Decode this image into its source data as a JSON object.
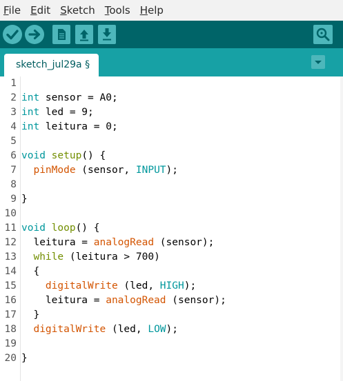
{
  "menubar": {
    "items": [
      {
        "label": "File",
        "mnemonic": "F",
        "rest": "ile"
      },
      {
        "label": "Edit",
        "mnemonic": "E",
        "rest": "dit"
      },
      {
        "label": "Sketch",
        "mnemonic": "S",
        "rest": "ketch"
      },
      {
        "label": "Tools",
        "mnemonic": "T",
        "rest": "ools"
      },
      {
        "label": "Help",
        "mnemonic": "H",
        "rest": "elp"
      }
    ]
  },
  "toolbar": {
    "buttons": [
      {
        "name": "verify",
        "icon": "check-icon"
      },
      {
        "name": "upload",
        "icon": "arrow-right-icon"
      },
      {
        "name": "new",
        "icon": "new-file-icon"
      },
      {
        "name": "open",
        "icon": "arrow-up-icon"
      },
      {
        "name": "save",
        "icon": "arrow-down-icon"
      },
      {
        "name": "serial-monitor",
        "icon": "magnifier-icon"
      }
    ],
    "background_color": "#006468",
    "button_color": "#4db7bb"
  },
  "tabs": {
    "active_label": "sketch_jul29a §",
    "menu_icon": "triangle-down-icon"
  },
  "editor": {
    "lines": [
      {
        "n": "1",
        "tokens": []
      },
      {
        "n": "2",
        "tokens": [
          [
            "type",
            "int"
          ],
          [
            "plain",
            " sensor = A0;"
          ]
        ]
      },
      {
        "n": "3",
        "tokens": [
          [
            "type",
            "int"
          ],
          [
            "plain",
            " led = 9;"
          ]
        ]
      },
      {
        "n": "4",
        "tokens": [
          [
            "type",
            "int"
          ],
          [
            "plain",
            " leitura = 0;"
          ]
        ]
      },
      {
        "n": "5",
        "tokens": []
      },
      {
        "n": "6",
        "tokens": [
          [
            "type",
            "void"
          ],
          [
            "plain",
            " "
          ],
          [
            "ctrl",
            "setup"
          ],
          [
            "plain",
            "() {"
          ]
        ]
      },
      {
        "n": "7",
        "tokens": [
          [
            "plain",
            "  "
          ],
          [
            "func",
            "pinMode"
          ],
          [
            "plain",
            " (sensor, "
          ],
          [
            "const",
            "INPUT"
          ],
          [
            "plain",
            ");"
          ]
        ]
      },
      {
        "n": "8",
        "tokens": []
      },
      {
        "n": "9",
        "tokens": [
          [
            "plain",
            "}"
          ]
        ]
      },
      {
        "n": "10",
        "tokens": []
      },
      {
        "n": "11",
        "tokens": [
          [
            "type",
            "void"
          ],
          [
            "plain",
            " "
          ],
          [
            "ctrl",
            "loop"
          ],
          [
            "plain",
            "() {"
          ]
        ]
      },
      {
        "n": "12",
        "tokens": [
          [
            "plain",
            "  leitura = "
          ],
          [
            "func",
            "analogRead"
          ],
          [
            "plain",
            " (sensor);"
          ]
        ]
      },
      {
        "n": "13",
        "tokens": [
          [
            "plain",
            "  "
          ],
          [
            "ctrl",
            "while"
          ],
          [
            "plain",
            " (leitura > 700)"
          ]
        ]
      },
      {
        "n": "14",
        "tokens": [
          [
            "plain",
            "  {"
          ]
        ]
      },
      {
        "n": "15",
        "tokens": [
          [
            "plain",
            "    "
          ],
          [
            "func",
            "digitalWrite"
          ],
          [
            "plain",
            " (led, "
          ],
          [
            "const",
            "HIGH"
          ],
          [
            "plain",
            ");"
          ]
        ]
      },
      {
        "n": "16",
        "tokens": [
          [
            "plain",
            "    leitura = "
          ],
          [
            "func",
            "analogRead"
          ],
          [
            "plain",
            " (sensor);"
          ]
        ]
      },
      {
        "n": "17",
        "tokens": [
          [
            "plain",
            "  }"
          ]
        ]
      },
      {
        "n": "18",
        "tokens": [
          [
            "plain",
            "  "
          ],
          [
            "func",
            "digitalWrite"
          ],
          [
            "plain",
            " (led, "
          ],
          [
            "const",
            "LOW"
          ],
          [
            "plain",
            ");"
          ]
        ]
      },
      {
        "n": "19",
        "tokens": []
      },
      {
        "n": "20",
        "tokens": [
          [
            "plain",
            "}"
          ]
        ]
      }
    ]
  }
}
